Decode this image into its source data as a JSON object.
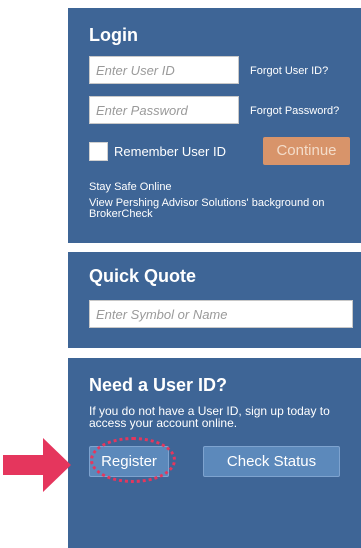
{
  "login": {
    "title": "Login",
    "user_id_placeholder": "Enter User ID",
    "forgot_user_id": "Forgot User ID?",
    "password_placeholder": "Enter Password",
    "forgot_password": "Forgot Password?",
    "remember_label": "Remember User ID",
    "continue_label": "Continue",
    "stay_safe": "Stay Safe Online",
    "broker_line1": "View Pershing Advisor Solutions' background on",
    "broker_line2": "BrokerCheck"
  },
  "quote": {
    "title": "Quick Quote",
    "placeholder": "Enter Symbol or Name"
  },
  "need_user_id": {
    "title": "Need a User ID?",
    "description": "If you do not have a User ID, sign up today to access your account online.",
    "register_label": "Register",
    "check_status_label": "Check Status"
  },
  "colors": {
    "panel": "#3e6596",
    "continue_button": "#d8946a",
    "highlight": "#e5365d"
  }
}
